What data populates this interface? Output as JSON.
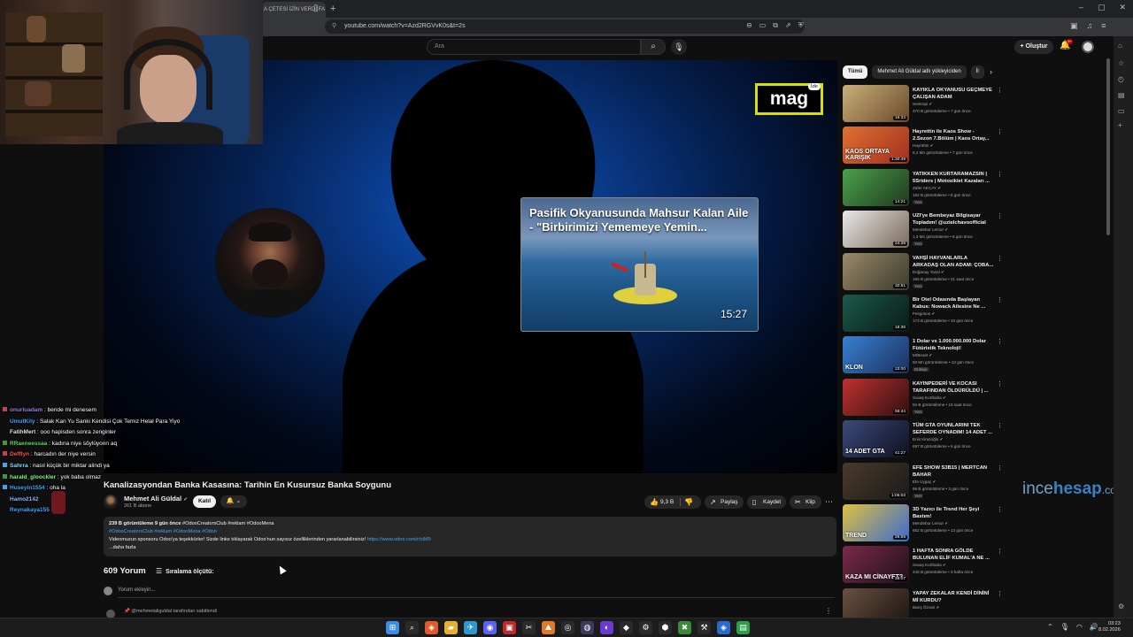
{
  "browser": {
    "tab_title": "A ÇETESİ İZİN VERDİ FA",
    "new_tab": "+",
    "url": "youtube.com/watch?v=Azd2RGVvK0s&t=2s",
    "window_controls": [
      "–",
      "▢",
      "✕"
    ]
  },
  "youtube_header": {
    "search_placeholder": "Ara",
    "create_label": "Oluştur",
    "notification_count": "9+"
  },
  "player": {
    "logo_text": "mag",
    "logo_badge": "İzle",
    "endcard_title": "Pasifik Okyanusunda Mahsur Kalan Aile - \"Birbirimizi Yememeye Yemin...",
    "endcard_duration": "15:27"
  },
  "watermark": {
    "part1": "ince",
    "part2": "hesap",
    "suffix": ".com"
  },
  "chat": [
    {
      "name": "onurluadam",
      "msg": "bende mi denesem",
      "color": "#9b7be0",
      "badge": "#c04060"
    },
    {
      "name": "UmutKily",
      "msg": "Salak Kan Yu Sanki Kendisi Çok Temiz Helal Para Yiyo",
      "color": "#3ea6ff",
      "badge": ""
    },
    {
      "name": "FatihMert",
      "msg": "ooo hapisden sonra zenginler",
      "color": "#e0e0e0",
      "badge": ""
    },
    {
      "name": "RRaeneessaa",
      "msg": "kadına niye söylüyonn aq",
      "color": "#5fd65f",
      "badge": "#3a9a3a"
    },
    {
      "name": "Defflyn",
      "msg": "harcadın der niye versin",
      "color": "#ff5050",
      "badge": "#c04060"
    },
    {
      "name": "Sahrra",
      "msg": "nasıl küçük bir miktar alindi ya",
      "color": "#8ad8ff",
      "badge": "#4aa0e0"
    },
    {
      "name": "harald_gloockler",
      "msg": "yok baba olmaz",
      "color": "#7aff7a",
      "badge": "#3a9a3a"
    },
    {
      "name": "Huseyin1554",
      "msg": "oha la",
      "color": "#3ea6ff",
      "badge": "#4aa0e0"
    },
    {
      "name": "Hamo2142",
      "msg": "",
      "color": "#8ab4f8",
      "badge": ""
    },
    {
      "name": "Reynakaya155",
      "msg": "",
      "color": "#3ea6ff",
      "badge": ""
    }
  ],
  "video": {
    "title": "Kanalizasyondan Banka Kasasına: Tarihin En Kusursuz Banka Soygunu",
    "channel": "Mehmet Ali Güldal",
    "subscribers": "261 B abone",
    "join_label": "Katıl",
    "subscribe_icon": "🔔 ⌄",
    "likes": "9,3 B",
    "share_label": "Paylaş",
    "save_label": "Kaydet",
    "clip_label": "Klip",
    "description": {
      "stats": "239 B görüntüleme  9 gün önce",
      "stats_tags": "#OdooCreatorsClub #reklam #OdooMena",
      "tags": "#OdooCreatorsClub #reklam #OdooMena #Odoo",
      "text": "Videomuzun sponsoru Odoo'ya teşekkürler! Sizde linke tıklayarak Odoo'nun sayısız özelliklerinden yararlanabilirsiniz!",
      "link": "https://www.odoo.com/r/ctM9",
      "more": "...daha fazla"
    }
  },
  "comments": {
    "count": "609 Yorum",
    "sort_label": "Sıralama ölçütü:",
    "input_placeholder": "Yorum ekleyin...",
    "pinned_label": "@mehmetaliguldal tarafından sabitlendi"
  },
  "chips": [
    "Tümü",
    "Mehmet Ali Güldal adlı yükleyiciden",
    "İl"
  ],
  "recommendations": [
    {
      "title": "KAYIKLA OKYANUSU GEÇMEYE ÇALIŞAN ADAM",
      "channel": "Sentropi",
      "meta": "470 B görüntüleme • 7 gün önce",
      "duration": "16:33",
      "new": "",
      "label": "",
      "bg": "linear-gradient(135deg,#c9b07a,#6a4a2a)"
    },
    {
      "title": "Hayrettin ile Kaos Show - 2.Sezon 7.Bölüm | Kaos Ortay...",
      "channel": "Hayrettin",
      "meta": "6,2 Mn görüntüleme • 7 gün önce",
      "duration": "1:30:49",
      "new": "",
      "label": "KAOS ORTAYA KARIŞIK",
      "bg": "linear-gradient(135deg,#e07030,#a03020)"
    },
    {
      "title": "YATIKKEN KURTARAMAZSIN | 5Sriders | Motosiklet Kazaları ...",
      "channel": "Zafer AKCAY",
      "meta": "162 B görüntüleme • 6 gün önce",
      "duration": "14:21",
      "new": "Yeni",
      "label": "",
      "bg": "linear-gradient(135deg,#4aa04a,#203a20)"
    },
    {
      "title": "UZI'ye Bembeyaz Bilgisayar Topladım! @uzielchavoofficial",
      "channel": "Mendebur Lemur",
      "meta": "1,3 Mn görüntüleme • 6 gün önce",
      "duration": "24:38",
      "new": "Yeni",
      "label": "",
      "bg": "linear-gradient(135deg,#e8e8e8,#7a6a5a)"
    },
    {
      "title": "VAHŞİ HAYVANLARLA ARKADAŞ OLAN ADAM: ÇOBA...",
      "channel": "Doğanay Yazal",
      "meta": "156 B görüntüleme • 21 saat önce",
      "duration": "32:51",
      "new": "Yeni",
      "label": "",
      "bg": "linear-gradient(135deg,#9a8a6a,#3a3a2a)"
    },
    {
      "title": "Bir Otel Odasında Başlayan Kabus: Nowack Ailesine Ne ...",
      "channel": "Fesgosoo",
      "meta": "173 B görüntüleme • 10 gün önce",
      "duration": "18:36",
      "new": "",
      "label": "",
      "bg": "linear-gradient(135deg,#1a5a4a,#0a1a18)"
    },
    {
      "title": "1 Dolar vs 1.000.000.000 Dolar Fütüristik Teknoloji!",
      "channel": "MrBeast",
      "meta": "93 Mn görüntüleme • 13 gün önce",
      "duration": "23:00",
      "new": "Dublajlı",
      "label": "KLON",
      "bg": "linear-gradient(135deg,#3a80d0,#1a3060)"
    },
    {
      "title": "KAYINPEDERİ VE KOCASI TARAFINDAN ÖLDÜRÜLDÜ | ...",
      "channel": "Savaş Kurtbaba",
      "meta": "94 B görüntüleme • 15 saat önce",
      "duration": "56:44",
      "new": "Yeni",
      "label": "",
      "bg": "linear-gradient(135deg,#c03030,#301010)"
    },
    {
      "title": "TÜM GTA OYUNLARINI TEK SEFERDE OYNADIM! 14 ADET ...",
      "channel": "Enis Kirazoğlu",
      "meta": "697 B görüntüleme • 6 gün önce",
      "duration": "41:27",
      "new": "",
      "label": "14 ADET GTA",
      "bg": "linear-gradient(135deg,#3a4a7a,#101020)"
    },
    {
      "title": "EFE SHOW S3B15 | MERTCAN BAHAR",
      "channel": "Efe Uygaç",
      "meta": "99 B görüntüleme • 3 gün önce",
      "duration": "1:05:03",
      "new": "Yeni",
      "label": "",
      "bg": "linear-gradient(135deg,#4a3a2a,#1a1a1a)"
    },
    {
      "title": "3D Yazıcı ile Trend Her Şeyi Bastım!",
      "channel": "Mendebur Lemur",
      "meta": "652 B görüntüleme • 13 gün önce",
      "duration": "26:59",
      "new": "",
      "label": "TREND",
      "bg": "linear-gradient(135deg,#e0c040,#3a6ad0)"
    },
    {
      "title": "1 HAFTA SONRA GÖLDE BULUNAN ELİF KUMAL'A NE ...",
      "channel": "Savaş Kurtbaba",
      "meta": "445 B görüntüleme • 3 hafta önce",
      "duration": "38:07",
      "new": "",
      "label": "KAZA MI CİNAYET?",
      "bg": "linear-gradient(135deg,#7a2a4a,#201018)"
    },
    {
      "title": "YAPAY ZEKALAR KENDİ DİNİNİ Mİ KURDU?",
      "channel": "Barış Özcan",
      "meta": "",
      "duration": "",
      "new": "",
      "label": "",
      "bg": "linear-gradient(135deg,#6a5040,#1a1410)"
    }
  ],
  "taskbar": {
    "icons": [
      {
        "glyph": "⊞",
        "color": "#3a8ee6",
        "name": "windows-start-icon"
      },
      {
        "glyph": "⌕",
        "color": "#2a2a2a",
        "name": "search-icon"
      },
      {
        "glyph": "◈",
        "color": "#e05a2a",
        "name": "brave-browser-icon"
      },
      {
        "glyph": "▰",
        "color": "#e8b030",
        "name": "file-explorer-icon"
      },
      {
        "glyph": "✈",
        "color": "#2a9ad0",
        "name": "telegram-icon"
      },
      {
        "glyph": "◉",
        "color": "#5865f2",
        "name": "discord-icon"
      },
      {
        "glyph": "▣",
        "color": "#c02a2a",
        "name": "video-editor-icon"
      },
      {
        "glyph": "✂",
        "color": "#2a2a2a",
        "name": "snipping-icon"
      },
      {
        "glyph": "⛰",
        "color": "#e07a2a",
        "name": "photo-app-icon"
      },
      {
        "glyph": "◎",
        "color": "#2a2a2a",
        "name": "obs-icon"
      },
      {
        "glyph": "◍",
        "color": "#3a3a5a",
        "name": "record-app-icon"
      },
      {
        "glyph": "◐",
        "color": "#6a3ad0",
        "name": "media-app-icon"
      },
      {
        "glyph": "◆",
        "color": "#2a2a2a",
        "name": "vpn-icon"
      },
      {
        "glyph": "⚙",
        "color": "#2a2a2a",
        "name": "settings-icon"
      },
      {
        "glyph": "⬢",
        "color": "#2a2a2a",
        "name": "game-launcher-icon"
      },
      {
        "glyph": "✖",
        "color": "#3a8a3a",
        "name": "xbox-icon"
      },
      {
        "glyph": "⚒",
        "color": "#2a2a2a",
        "name": "tool-icon"
      },
      {
        "glyph": "◈",
        "color": "#2a6ad0",
        "name": "app-icon"
      },
      {
        "glyph": "▤",
        "color": "#2aa04a",
        "name": "sheets-icon"
      }
    ],
    "time": "03:23",
    "date": "8.02.2026"
  }
}
